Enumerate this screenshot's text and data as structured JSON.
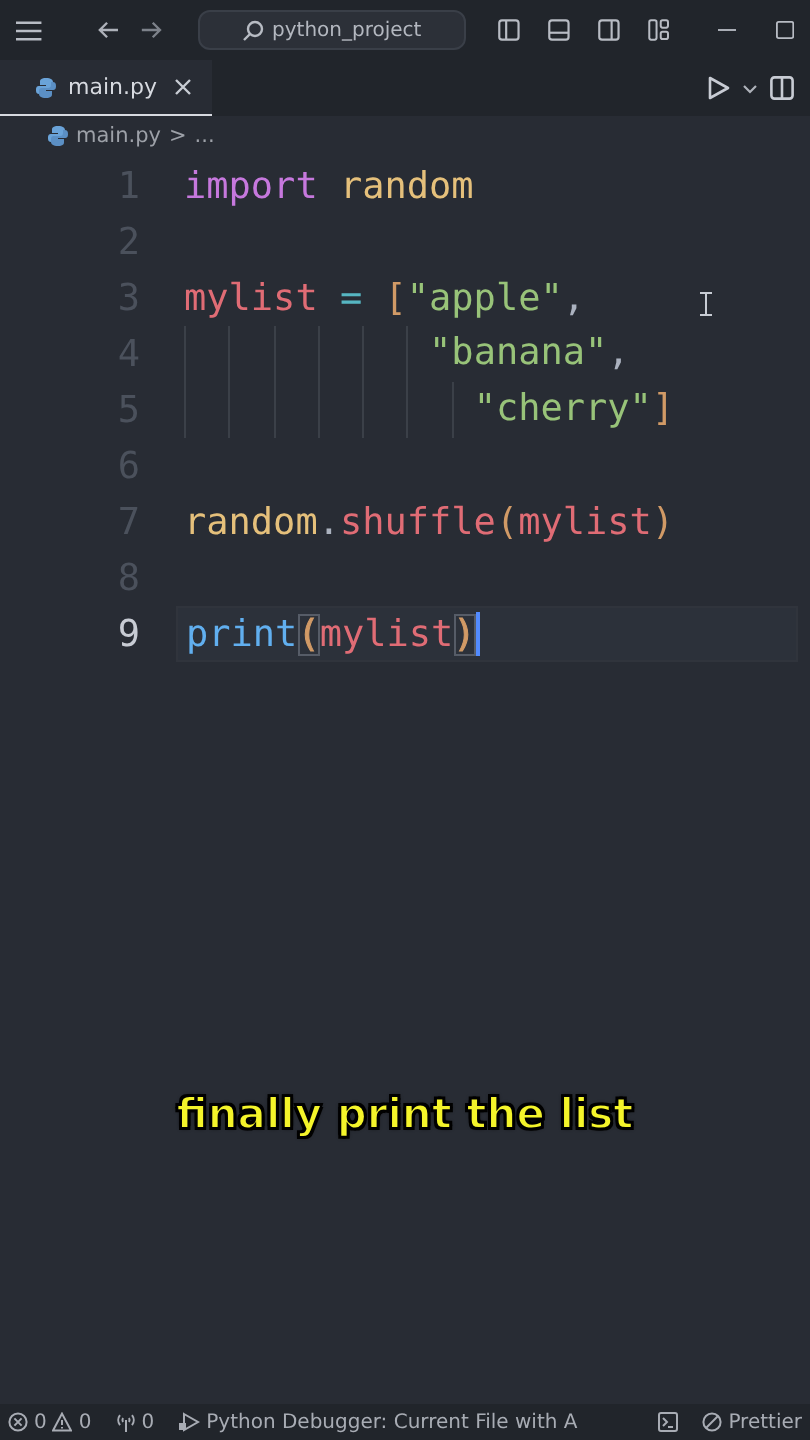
{
  "title_bar": {
    "search": "python_project"
  },
  "tabs": [
    {
      "label": "main.py",
      "selected": true
    }
  ],
  "breadcrumb": {
    "file": "main.py",
    "separator": ">",
    "rest": "..."
  },
  "editor": {
    "lines": [
      {
        "number": "1",
        "current": false,
        "tokens": [
          {
            "text": "import ",
            "color": "#c678dd"
          },
          {
            "text": "random",
            "color": "#e5c07b"
          }
        ]
      },
      {
        "number": "2",
        "current": false
      },
      {
        "number": "3",
        "current": false,
        "tokens": [
          {
            "text": "mylist ",
            "color": "#e06c75"
          },
          {
            "text": "= ",
            "color": "#56b6c2"
          },
          {
            "text": "[",
            "color": "#d19a66"
          },
          {
            "text": "\"apple\"",
            "color": "#98c379"
          },
          {
            "text": ",",
            "color": "#abb2bf"
          }
        ]
      },
      {
        "number": "4",
        "current": false,
        "tokens": [
          {
            "text": "           \"banana\"",
            "color": "#98c379"
          },
          {
            "text": ",",
            "color": "#abb2bf"
          }
        ]
      },
      {
        "number": "5",
        "current": false,
        "tokens": [
          {
            "text": "             \"cherry\"",
            "color": "#98c379"
          },
          {
            "text": "]",
            "color": "#d19a66"
          }
        ]
      },
      {
        "number": "6",
        "current": false
      },
      {
        "number": "7",
        "current": false,
        "tokens": [
          {
            "text": "random",
            "color": "#e5c07b"
          },
          {
            "text": ".",
            "color": "#abb2bf"
          },
          {
            "text": "shuffle",
            "color": "#e06c75"
          },
          {
            "text": "(",
            "color": "#d19a66"
          },
          {
            "text": "mylist",
            "color": "#e06c75"
          },
          {
            "text": ")",
            "color": "#d19a66"
          }
        ]
      },
      {
        "number": "8",
        "current": false
      },
      {
        "number": "9",
        "current": true,
        "tokens": [
          {
            "text": "print",
            "color": "#61afef",
            "highlighted": false
          },
          {
            "text": "(",
            "color": "#d19a66",
            "highlighted": true
          },
          {
            "text": "mylist",
            "color": "#e06c75",
            "highlighted": false
          },
          {
            "text": ")",
            "color": "#d19a66",
            "highlighted": true
          }
        ]
      }
    ]
  },
  "caption": "finally print the list",
  "status_bar": {
    "errors": "0",
    "warnings": "0",
    "ports": "0",
    "debug": "Python Debugger: Current File with A",
    "formatter": "Prettier"
  }
}
